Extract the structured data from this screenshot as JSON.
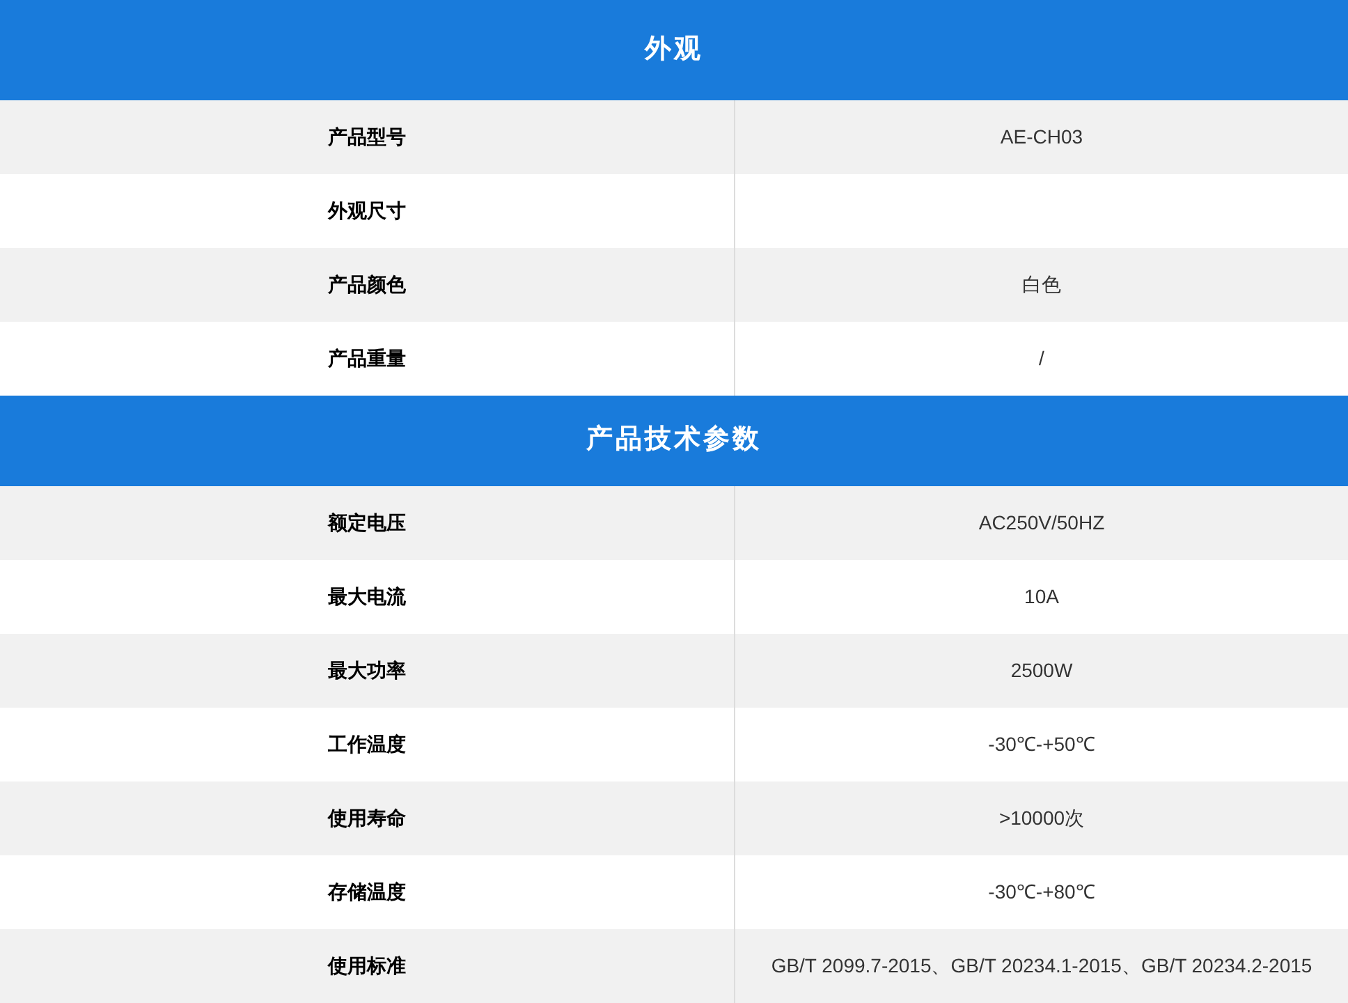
{
  "sections": [
    {
      "title": "外观",
      "rows": [
        {
          "label": "产品型号",
          "value": "AE-CH03"
        },
        {
          "label": "外观尺寸"
        },
        {
          "label": "产品颜色",
          "value": "白色"
        },
        {
          "label": "产品重量",
          "value": "/"
        }
      ]
    },
    {
      "title": "产品技术参数",
      "rows": [
        {
          "label": "额定电压",
          "value": "AC250V/50HZ"
        },
        {
          "label": "最大电流",
          "value": "10A"
        },
        {
          "label": "最大功率",
          "value": "2500W"
        },
        {
          "label": "工作温度",
          "value": "-30℃-+50℃"
        },
        {
          "label": "使用寿命",
          "value": ">10000次"
        },
        {
          "label": "存储温度",
          "value": "-30℃-+80℃"
        },
        {
          "label": "使用标准",
          "value": "GB/T 2099.7-2015、GB/T 20234.1-2015、GB/T 20234.2-2015"
        }
      ]
    }
  ]
}
